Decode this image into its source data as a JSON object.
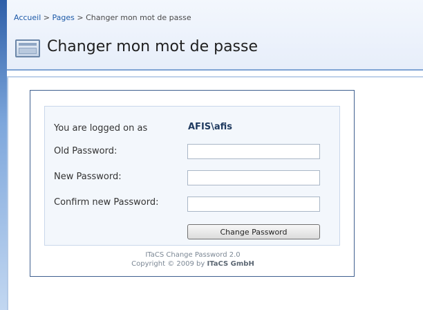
{
  "breadcrumb": {
    "items": [
      "Accueil",
      "Pages",
      "Changer mon mot de passe"
    ],
    "separator": ">"
  },
  "page": {
    "title": "Changer mon mot de passe",
    "icon": "page-icon"
  },
  "form": {
    "logged_on_label": "You are logged on as",
    "user": "AFIS\\afis",
    "old_password_label": "Old Password:",
    "new_password_label": "New Password:",
    "confirm_password_label": "Confirm new Password:",
    "old_password_value": "",
    "new_password_value": "",
    "confirm_password_value": "",
    "submit_label": "Change Password"
  },
  "footer": {
    "product": "ITaCS Change Password 2.0",
    "copyright_prefix": "Copyright © 2009 by ",
    "company": "ITaCS GmbH"
  },
  "colors": {
    "link": "#1d5aa7",
    "header_bg": "#e7eefa",
    "header_rule": "#7ea3d4",
    "panel_border": "#3f5f8f",
    "inner_bg": "#f3f7fc"
  }
}
